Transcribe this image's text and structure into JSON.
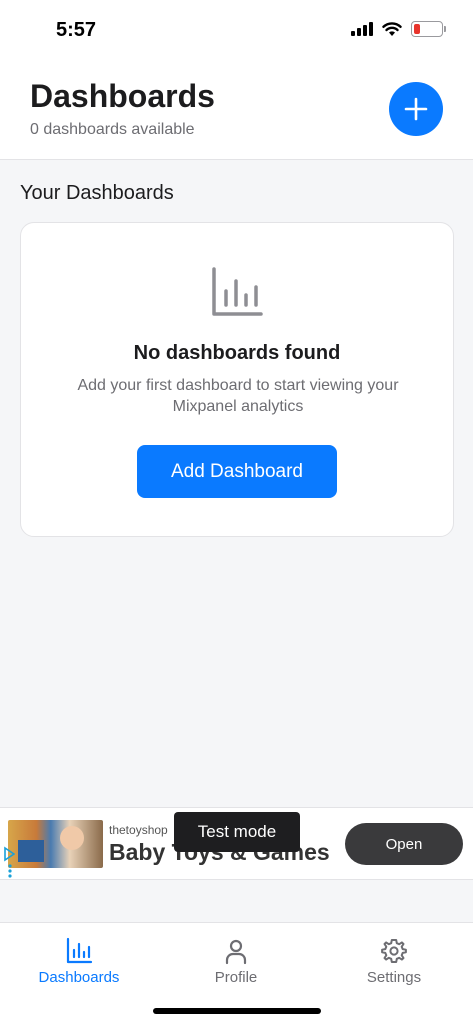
{
  "status_bar": {
    "time": "5:57",
    "battery_color": "#e8342c"
  },
  "header": {
    "title": "Dashboards",
    "subtitle": "0 dashboards available",
    "add_icon": "plus-icon"
  },
  "section": {
    "title": "Your Dashboards"
  },
  "empty_state": {
    "icon": "bar-chart-icon",
    "title": "No dashboards found",
    "description": "Add your first dashboard to start viewing your Mixpanel analytics",
    "button_label": "Add Dashboard"
  },
  "ad": {
    "brand": "thetoyshop",
    "headline": "Baby Toys & Games",
    "test_mode_label": "Test mode",
    "open_label": "Open"
  },
  "tabs": [
    {
      "label": "Dashboards",
      "icon": "bar-chart-icon",
      "active": true
    },
    {
      "label": "Profile",
      "icon": "person-icon",
      "active": false
    },
    {
      "label": "Settings",
      "icon": "gear-icon",
      "active": false
    }
  ],
  "colors": {
    "accent": "#0a7aff",
    "text_primary": "#1c1c1e",
    "text_secondary": "#6d6d72"
  }
}
